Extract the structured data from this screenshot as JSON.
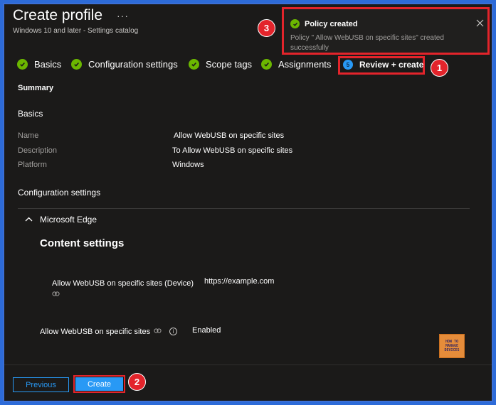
{
  "header": {
    "title": "Create profile",
    "more": "···",
    "subtitle": "Windows 10 and later - Settings catalog"
  },
  "steps": [
    {
      "label": "Basics",
      "state": "done"
    },
    {
      "label": "Configuration settings",
      "state": "done"
    },
    {
      "label": "Scope tags",
      "state": "done"
    },
    {
      "label": "Assignments",
      "state": "done"
    },
    {
      "label": "Review + create",
      "state": "current",
      "number": "5"
    }
  ],
  "badges": {
    "one": "1",
    "two": "2",
    "three": "3"
  },
  "summary": {
    "heading": "Summary",
    "basics_heading": "Basics",
    "rows": [
      {
        "label": "Name",
        "value": "Allow WebUSB on specific sites"
      },
      {
        "label": "Description",
        "value": "To  Allow WebUSB on specific sites"
      },
      {
        "label": "Platform",
        "value": "Windows"
      }
    ],
    "config_heading": "Configuration settings"
  },
  "edge": {
    "label": "Microsoft Edge",
    "content_heading": "Content settings",
    "settings": [
      {
        "label": "Allow WebUSB on specific sites (Device)",
        "value": "https://example.com"
      },
      {
        "label": "Allow WebUSB on specific sites",
        "value": "Enabled"
      }
    ]
  },
  "logo": {
    "line1": "HOW TO",
    "line2": "MANAGE",
    "line3": "DEVICES"
  },
  "footer": {
    "previous": "Previous",
    "create": "Create"
  },
  "toast": {
    "title": "Policy created",
    "message": "Policy \" Allow WebUSB on specific sites\" created successfully"
  },
  "colors": {
    "accent": "#2899f5",
    "success": "#6bb700",
    "highlight": "#e3242b"
  }
}
